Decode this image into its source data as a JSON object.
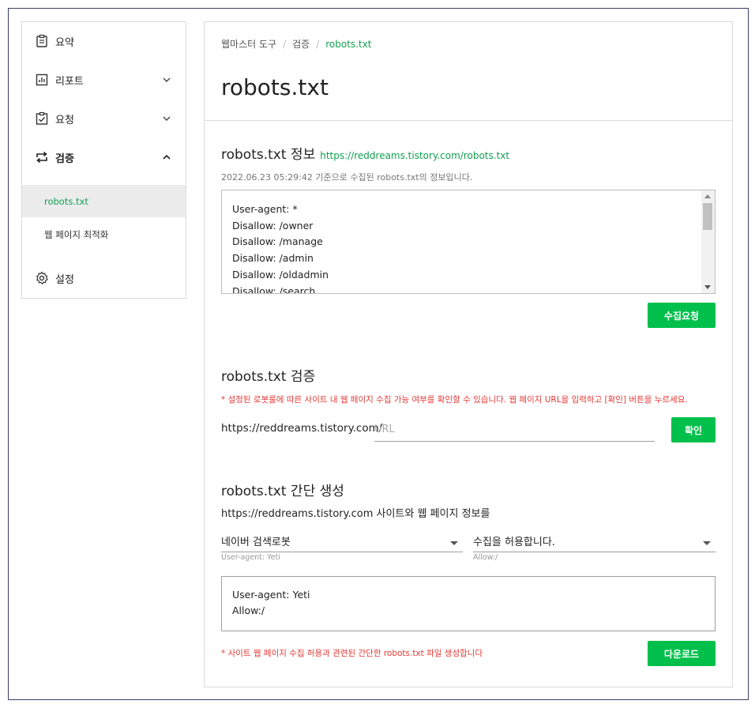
{
  "sidebar": {
    "items": [
      {
        "label": "요약",
        "icon": "clipboard-icon"
      },
      {
        "label": "리포트",
        "icon": "bar-chart-icon"
      },
      {
        "label": "요청",
        "icon": "clipboard-check-icon"
      },
      {
        "label": "검증",
        "icon": "swap-arrows-icon"
      },
      {
        "label": "설정",
        "icon": "gear-icon"
      }
    ],
    "subitems": [
      {
        "label": "robots.txt"
      },
      {
        "label": "웹 페이지 최적화"
      }
    ]
  },
  "breadcrumb": {
    "items": [
      "웹마스터 도구",
      "검증"
    ],
    "current": "robots.txt",
    "separator": "/"
  },
  "page_title": "robots.txt",
  "info": {
    "title": "robots.txt 정보",
    "link": "https://reddreams.tistory.com/robots.txt",
    "collected": "2022.06.23 05:29:42 기준으로 수집된 robots.txt의 정보입니다.",
    "lines": [
      "User-agent: *",
      "Disallow: /owner",
      "Disallow: /manage",
      "Disallow: /admin",
      "Disallow: /oldadmin",
      "Disallow: /search"
    ],
    "collect_button": "수집요청"
  },
  "verify": {
    "title": "robots.txt 검증",
    "note": "* 설정된 로봇룰에 따른 사이트 내 웹 페이지 수집 가능 여부를 확인할 수 있습니다. 웹 페이지 URL을 입력하고 [확인] 버튼을 누르세요.",
    "prefix": "https://reddreams.tistory.com/",
    "placeholder": "URL",
    "confirm_button": "확인"
  },
  "generate": {
    "title": "robots.txt 간단 생성",
    "desc": "https://reddreams.tistory.com 사이트와 웹 페이지 정보를",
    "agent_select": "네이버 검색로봇",
    "agent_hint": "User-agent: Yeti",
    "allow_select": "수집을 허용합니다.",
    "allow_hint": "Allow:/",
    "output_lines": [
      "User-agent: Yeti",
      "Allow:/"
    ],
    "note": "* 사이트 웹 페이지 수집 허용과 관련된 간단한 robots.txt 파일 생성합니다",
    "download_button": "다운로드"
  },
  "colors": {
    "accent": "#00c04b",
    "link": "#12a050",
    "warning": "#e53935"
  }
}
